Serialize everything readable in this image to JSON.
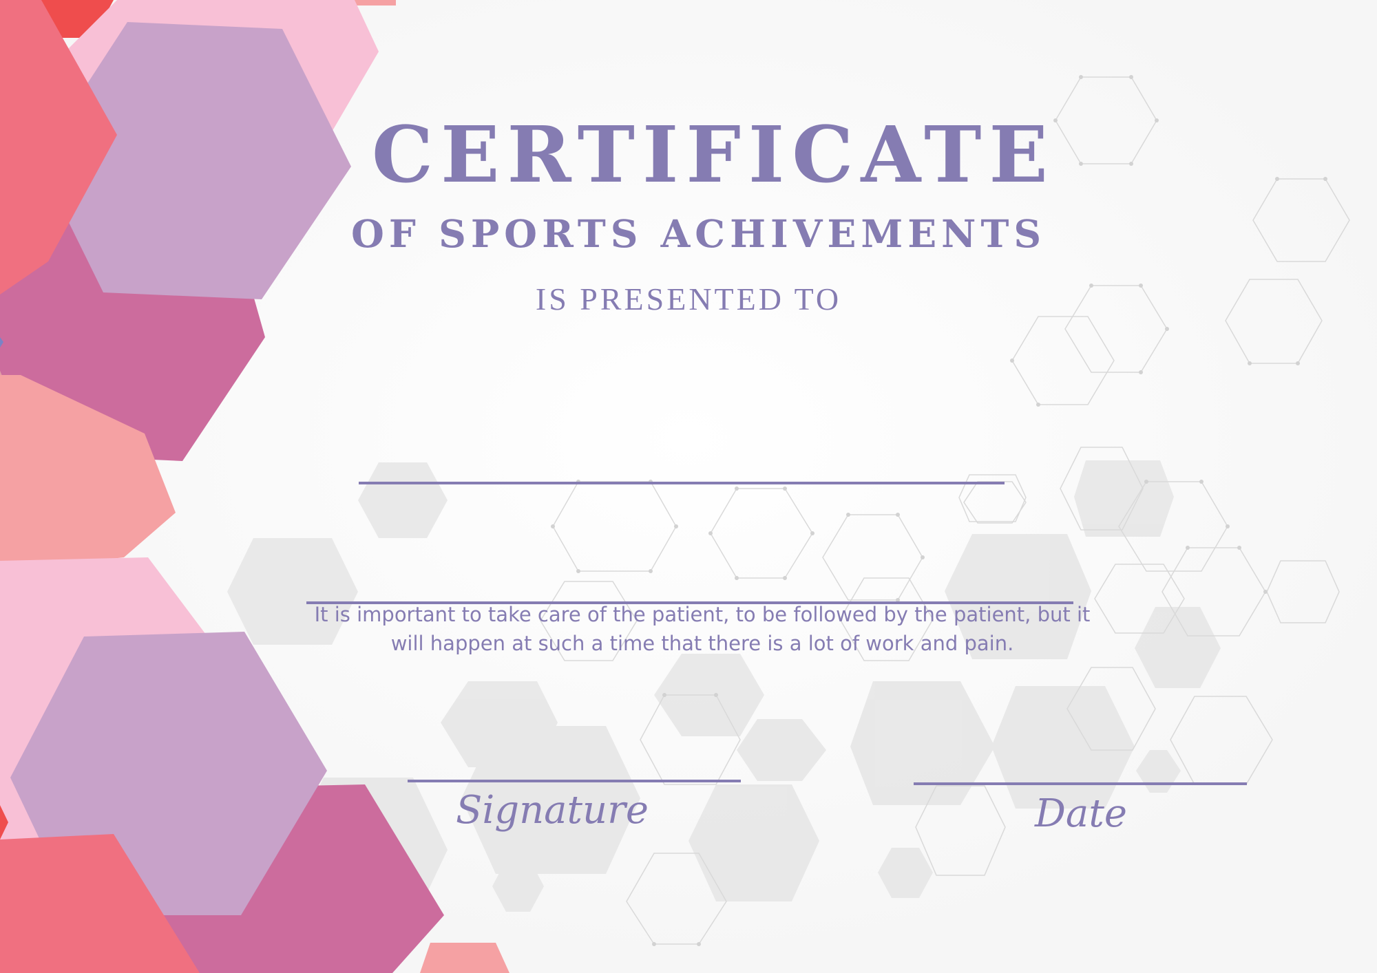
{
  "certificate": {
    "title": "CERTIFICATE",
    "subtitle": "OF SPORTS ACHIVEMENTS",
    "presented_to": "IS PRESENTED TO",
    "recipient_name": "",
    "body": "It is important to take care of the patient, to be followed by the patient, but it will happen at such a time that there is a lot of work and pain.",
    "signature_label": "Signature",
    "date_label": "Date"
  },
  "colors": {
    "text": "#857cb2",
    "background": "#fbfbfb",
    "hex_lavender": "#c8a2c9",
    "hex_magenta": "#cc6c9d",
    "hex_coral": "#f07080",
    "hex_salmon": "#f5a1a3",
    "hex_pink": "#f8c0d6",
    "hex_red": "#ef4d4d",
    "hex_grey": "#e6e6e6",
    "outline_grey": "#d9d9d9"
  }
}
